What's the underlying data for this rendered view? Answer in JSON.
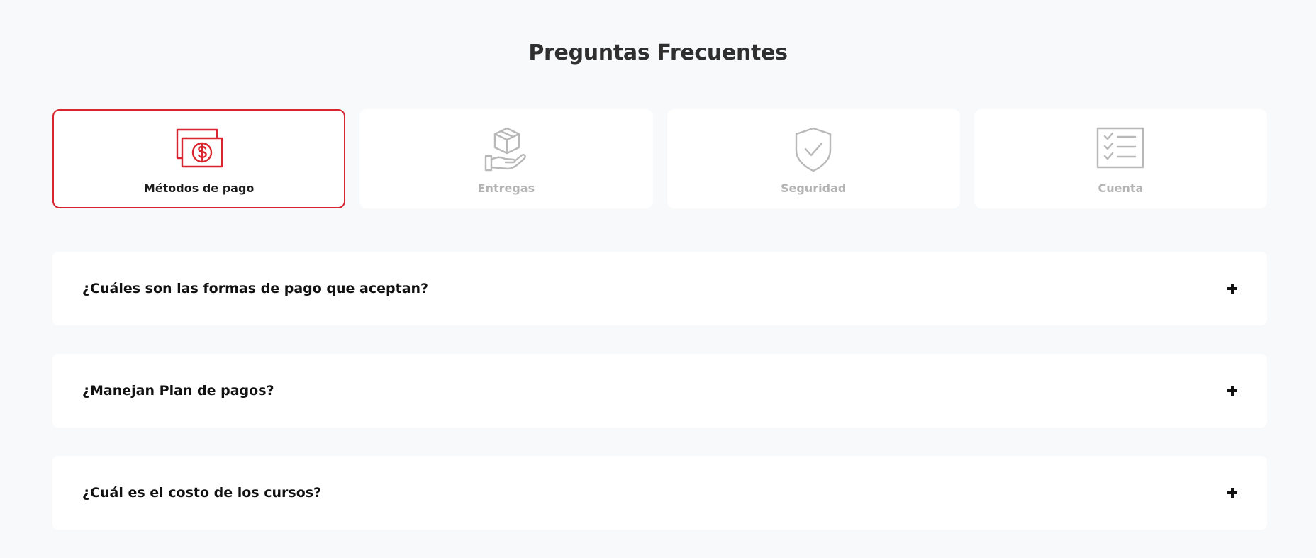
{
  "page": {
    "title": "Preguntas Frecuentes"
  },
  "categories": [
    {
      "label": "Métodos de pago",
      "icon": "money-bills-icon",
      "active": true
    },
    {
      "label": "Entregas",
      "icon": "box-hand-icon",
      "active": false
    },
    {
      "label": "Seguridad",
      "icon": "shield-check-icon",
      "active": false
    },
    {
      "label": "Cuenta",
      "icon": "checklist-icon",
      "active": false
    }
  ],
  "faqs": [
    {
      "question": "¿Cuáles son las formas de pago que aceptan?",
      "expanded": false
    },
    {
      "question": "¿Manejan Plan de pagos?",
      "expanded": false
    },
    {
      "question": "¿Cuál es el costo de los cursos?",
      "expanded": false
    }
  ],
  "colors": {
    "accent": "#d9262e",
    "inactive_icon": "#b8b8b8",
    "background": "#f8f9fb",
    "card": "#ffffff"
  }
}
